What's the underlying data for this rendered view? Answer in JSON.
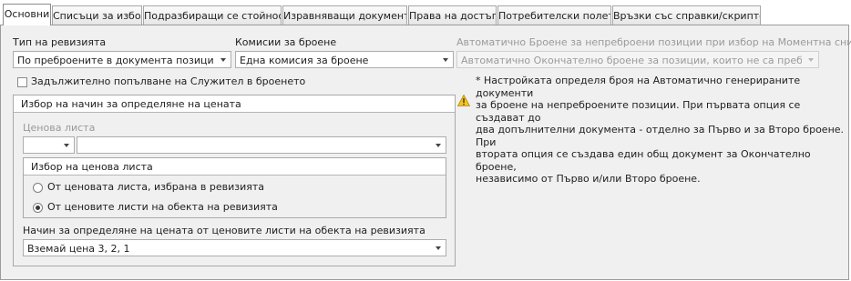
{
  "tabs": [
    {
      "label": "Основни",
      "active": true
    },
    {
      "label": "Списъци за избор"
    },
    {
      "label": "Подразбиращи се стойности"
    },
    {
      "label": "Изравняващи документи"
    },
    {
      "label": "Права на достъп"
    },
    {
      "label": "Потребителски полета"
    },
    {
      "label": "Връзки със справки/скриптове"
    }
  ],
  "revision_type": {
    "label": "Тип на ревизията",
    "value": "По преброените в документа позиции"
  },
  "count_commissions": {
    "label": "Комисии за броене",
    "value": "Една комисия за броене"
  },
  "auto_count": {
    "label": "Автоматично Броене за непреброени позиции при избор на Моментна снимка*",
    "value": "Автоматично Окончателно броене за позиции, които не са преброени (ня"
  },
  "mandatory_employee": {
    "label": "Задължително попълване на Служител в броенето",
    "checked": false
  },
  "price_group": {
    "title": "Избор на начин за определяне на цената",
    "price_list_label": "Ценова листа",
    "price_list_code": "",
    "price_list_name": "",
    "price_list_choice": {
      "title": "Избор на ценова листа",
      "options": [
        {
          "label": "От ценовата листа, избрана в ревизията",
          "selected": false
        },
        {
          "label": "От ценовите листи на обекта на ревизията",
          "selected": true
        }
      ]
    },
    "method_label": "Начин за определяне на цената от ценовите листи на обекта на ревизията",
    "method_value": "Вземай цена 3, 2, 1"
  },
  "note": {
    "lines": [
      "* Настройката определя броя на Автоматично генерираните документи",
      "за броене на непреброените позиции. При първата опция се създават до",
      "два допълнителни документа - отделно за Първо и за Второ броене. При",
      "втората опция се създава един общ документ за Окончателно броене,",
      "независимо от Първо и/или Второ броене."
    ],
    "icon": "warning-icon"
  },
  "colors": {
    "warning": "#f5c518",
    "panel": "#f0f0f0"
  }
}
